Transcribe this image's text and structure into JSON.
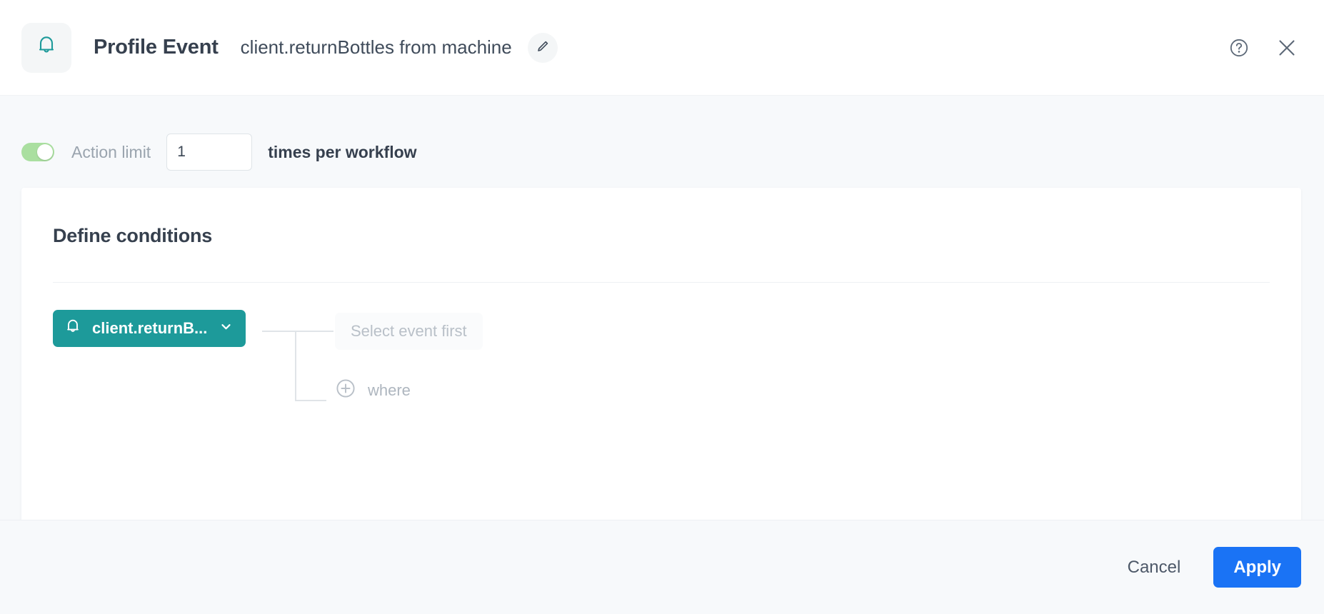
{
  "header": {
    "icon": "bell-icon",
    "kind": "Profile Event",
    "name": "client.returnBottles from machine",
    "edit_icon": "pencil-icon",
    "help_icon": "help-circle-icon",
    "close_icon": "close-icon"
  },
  "action_limit": {
    "toggle_state": "on",
    "label": "Action limit",
    "value": "1",
    "placeholder": "",
    "suffix": "times per workflow"
  },
  "conditions": {
    "title": "Define conditions",
    "event_chip": {
      "icon": "bell-icon",
      "label": "client.returnB...",
      "chevron": "chevron-down-icon"
    },
    "property_placeholder": "Select event first",
    "where": {
      "icon": "plus-circle-icon",
      "label": "where"
    }
  },
  "footer": {
    "cancel_label": "Cancel",
    "apply_label": "Apply"
  },
  "colors": {
    "accent_teal": "#1d9a9a",
    "primary_blue": "#1a73f5",
    "toggle_green": "#aadfa0",
    "page_bg": "#f7f9fb"
  }
}
